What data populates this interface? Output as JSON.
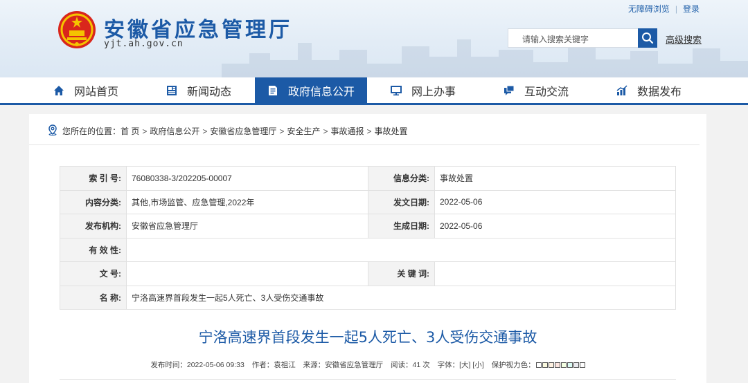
{
  "top_links": {
    "accessibility": "无障碍浏览",
    "login": "登录"
  },
  "site": {
    "title": "安徽省应急管理厅",
    "domain": "yjt.ah.gov.cn"
  },
  "search": {
    "placeholder": "请输入搜索关键字",
    "advanced": "高级搜索",
    "icon": "search-icon"
  },
  "nav": [
    {
      "label": "网站首页",
      "icon": "home-icon"
    },
    {
      "label": "新闻动态",
      "icon": "news-icon"
    },
    {
      "label": "政府信息公开",
      "icon": "document-icon"
    },
    {
      "label": "网上办事",
      "icon": "monitor-icon"
    },
    {
      "label": "互动交流",
      "icon": "chat-icon"
    },
    {
      "label": "数据发布",
      "icon": "chart-icon"
    }
  ],
  "breadcrumb": {
    "prefix": "您所在的位置：",
    "items": [
      "首 页",
      "政府信息公开",
      "安徽省应急管理厅",
      "安全生产",
      "事故通报",
      "事故处置"
    ],
    "separator": ">"
  },
  "meta": {
    "index_label": "索 引 号:",
    "index_value": "76080338-3/202205-00007",
    "info_category_label": "信息分类:",
    "info_category_value": "事故处置",
    "content_category_label": "内容分类:",
    "content_category_value": "其他,市场监管、应急管理,2022年",
    "publish_date_label": "发文日期:",
    "publish_date_value": "2022-05-06",
    "publisher_label": "发布机构:",
    "publisher_value": "安徽省应急管理厅",
    "generate_date_label": "生成日期:",
    "generate_date_value": "2022-05-06",
    "validity_label": "有 效 性:",
    "validity_value": "",
    "doc_number_label": "文 号:",
    "doc_number_value": "",
    "keywords_label": "关 键 词:",
    "keywords_value": "",
    "name_label": "名 称:",
    "name_value": "宁洛高速界首段发生一起5人死亡、3人受伤交通事故"
  },
  "article": {
    "title": "宁洛高速界首段发生一起5人死亡、3人受伤交通事故",
    "publish_time_label": "发布时间：",
    "publish_time": "2022-05-06 09:33",
    "author_label": "作者：",
    "author": "袁祖江",
    "source_label": "来源：",
    "source": "安徽省应急管理厅",
    "views_label": "阅读：",
    "views": "41 次",
    "font_label": "字体：",
    "font_large": "[大]",
    "font_small": "[小]",
    "eye_label": "保护视力色：",
    "eye_colors": [
      "#ffffff",
      "#faf9de",
      "#fff2e2",
      "#fde6e0",
      "#f3ffe1",
      "#dafaf4",
      "#eaeaef",
      "#ffffff"
    ]
  },
  "colors": {
    "brand": "#1c5aa6",
    "nav_active": "#1c5aa6"
  }
}
